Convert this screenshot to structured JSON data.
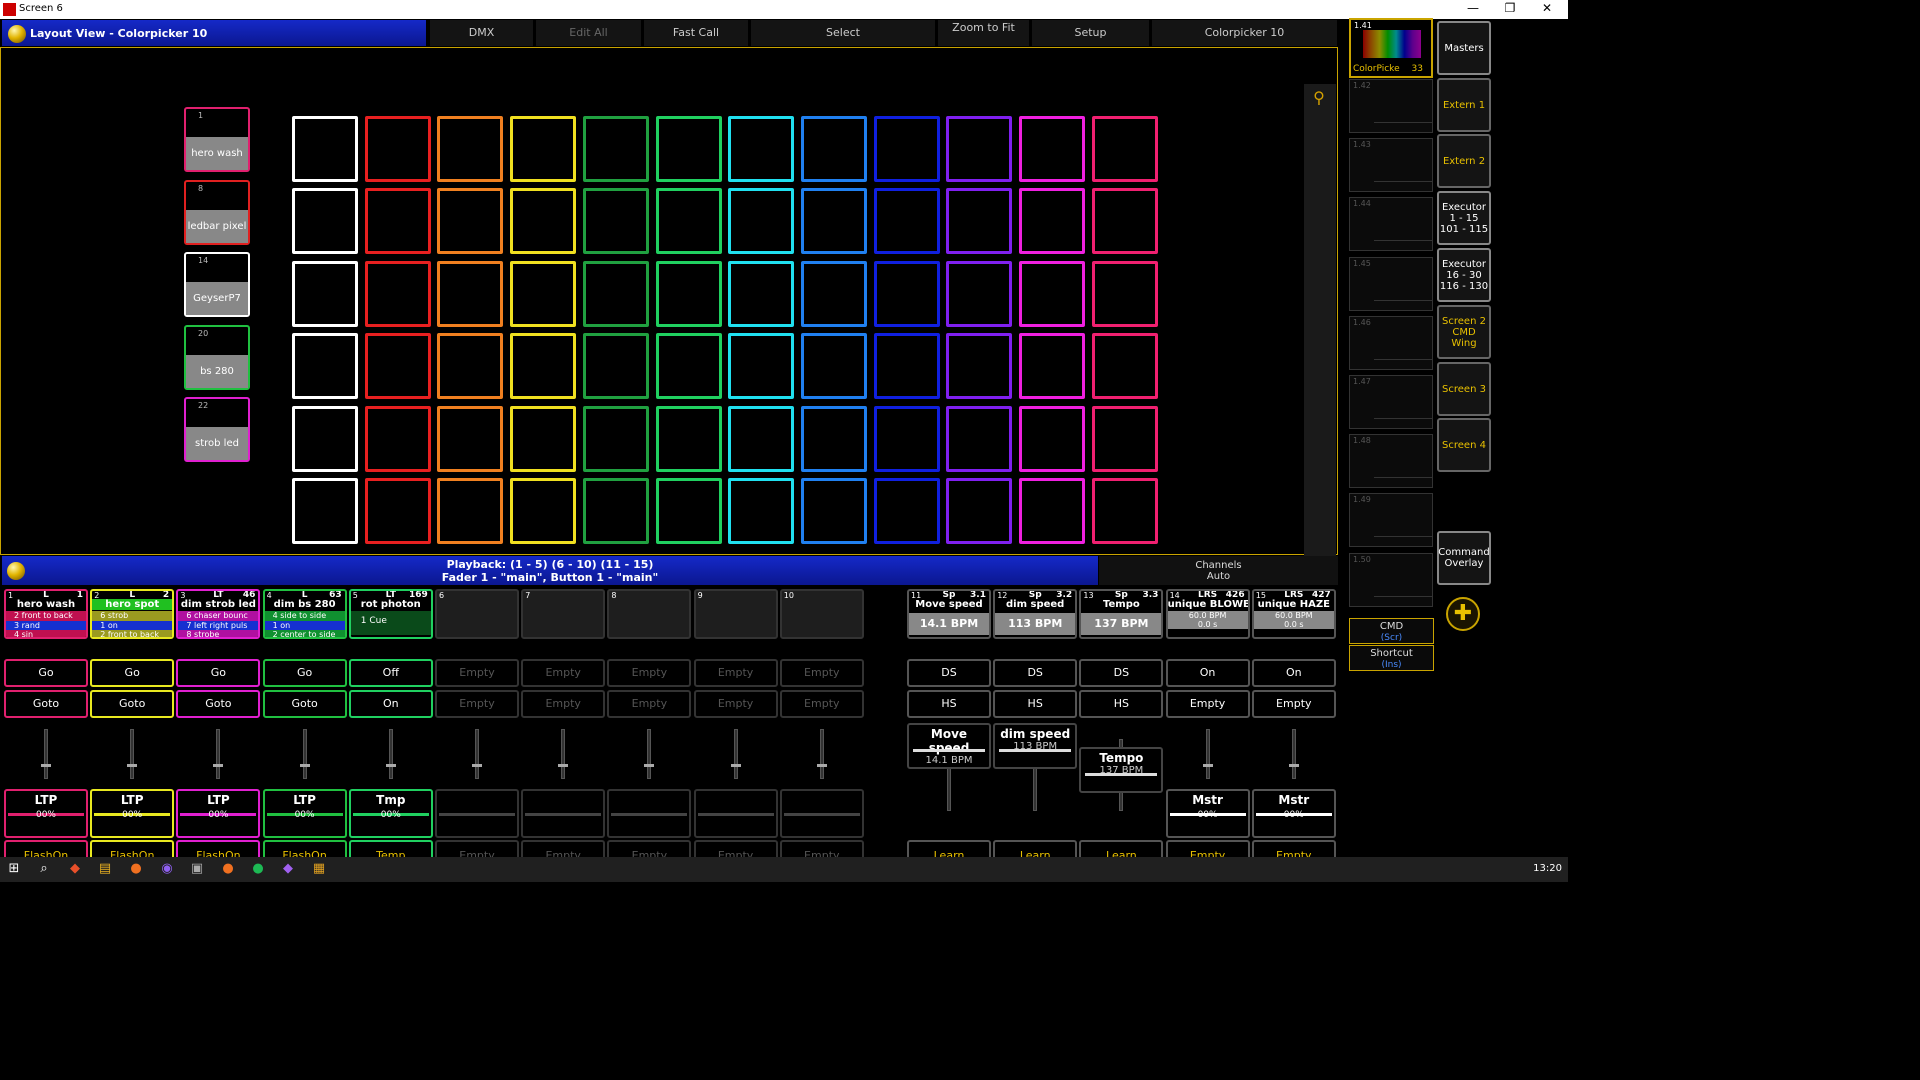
{
  "window": {
    "title": "Screen 6",
    "controls": [
      "—",
      "❐",
      "✕"
    ]
  },
  "header": {
    "title": "Layout View - Colorpicker 10",
    "buttons": [
      "DMX",
      "Edit All",
      "Fast Call",
      "Select",
      "Zoom to Fit",
      "Setup",
      "Colorpicker 10"
    ]
  },
  "fixtures": [
    {
      "num": "1",
      "label": "hero wash",
      "color": "#e0206e"
    },
    {
      "num": "8",
      "label": "ledbar pixel",
      "color": "#e02020"
    },
    {
      "num": "14",
      "label": "GeyserP7",
      "color": "#ffffff"
    },
    {
      "num": "20",
      "label": "bs 280",
      "color": "#20c040"
    },
    {
      "num": "22",
      "label": "strob led",
      "color": "#e020d0"
    }
  ],
  "grid": {
    "rows": 6,
    "colors": [
      "#ffffff",
      "#e82020",
      "#f08020",
      "#f0e020",
      "#20a040",
      "#20d060",
      "#20e0f0",
      "#2080f0",
      "#1020e0",
      "#8020f0",
      "#f020e0",
      "#f02070"
    ]
  },
  "playback": {
    "line1": "Playback: (1 - 5) (6 - 10) (11 - 15)",
    "line2": "Fader  1 - \"main\", Button  1 - \"main\"",
    "channels": "Channels",
    "auto": "Auto"
  },
  "executors": [
    {
      "num": "1",
      "type": "L",
      "right": "1",
      "name": "hero wash",
      "color": "#e0206e",
      "namebg": "#000",
      "cues": [
        {
          "t": "2 front to back",
          "bg": "#c01050"
        },
        {
          "t": "3 rand",
          "bg": "#1530d0"
        },
        {
          "t": "4 sin",
          "bg": "#c01050"
        }
      ],
      "b1": "Go",
      "b2": "Goto",
      "fader": "LTP",
      "pct": "00%",
      "barcolor": "#e0206e",
      "bottom": "FlashOn",
      "bcolor": "#e8c000"
    },
    {
      "num": "2",
      "type": "L",
      "right": "2",
      "name": "hero spot",
      "color": "#e8e820",
      "namebg": "#20c020",
      "cues": [
        {
          "t": "6 strob",
          "bg": "#9a9a20"
        },
        {
          "t": "1 on",
          "bg": "#1530d0"
        },
        {
          "t": "2 front to back",
          "bg": "#9a9a20"
        }
      ],
      "b1": "Go",
      "b2": "Goto",
      "fader": "LTP",
      "pct": "00%",
      "barcolor": "#e8e820",
      "bottom": "FlashOn",
      "bcolor": "#e8c000"
    },
    {
      "num": "3",
      "type": "LT",
      "right": "46",
      "name": "dim strob led",
      "color": "#e020d0",
      "namebg": "#000",
      "cues": [
        {
          "t": "6 chaser bounc",
          "bg": "#b010a0"
        },
        {
          "t": "7 left right puls",
          "bg": "#1530d0"
        },
        {
          "t": "8 strobe",
          "bg": "#b010a0"
        }
      ],
      "b1": "Go",
      "b2": "Goto",
      "fader": "LTP",
      "pct": "00%",
      "barcolor": "#e020d0",
      "bottom": "FlashOn",
      "bcolor": "#e8c000"
    },
    {
      "num": "4",
      "type": "L",
      "right": "63",
      "name": "dim bs 280",
      "color": "#20c040",
      "namebg": "#000",
      "cues": [
        {
          "t": "4 side to side",
          "bg": "#109030"
        },
        {
          "t": "1 on",
          "bg": "#1530d0"
        },
        {
          "t": "2 center to side",
          "bg": "#109030"
        }
      ],
      "b1": "Go",
      "b2": "Goto",
      "fader": "LTP",
      "pct": "00%",
      "barcolor": "#20c040",
      "bottom": "FlashOn",
      "bcolor": "#e8c000"
    },
    {
      "num": "5",
      "type": "LT",
      "right": "169",
      "name": "rot photon",
      "color": "#20d060",
      "namebg": "#000",
      "cues": [
        {
          "t": "1 Cue",
          "bg": "#0a4a1a"
        }
      ],
      "b1": "Off",
      "b2": "On",
      "fader": "Tmp",
      "pct": "00%",
      "barcolor": "#20d060",
      "bottom": "Temp",
      "bcolor": "#e8c000"
    },
    {
      "num": "6",
      "empty": true
    },
    {
      "num": "7",
      "empty": true
    },
    {
      "num": "8",
      "empty": true
    },
    {
      "num": "9",
      "empty": true
    },
    {
      "num": "10",
      "empty": true
    }
  ],
  "empty": {
    "label": "Empty"
  },
  "speedexecs": [
    {
      "num": "11",
      "type": "Sp",
      "right": "3.1",
      "name": "Move speed",
      "bpm": "14.1 BPM",
      "b1": "DS",
      "b2": "HS",
      "spd": "Move speed",
      "spdv": "14.1 BPM",
      "bottom": "Learn"
    },
    {
      "num": "12",
      "type": "Sp",
      "right": "3.2",
      "name": "dim speed",
      "bpm": "113 BPM",
      "b1": "DS",
      "b2": "HS",
      "spd": "dim speed",
      "spdv": "113 BPM",
      "bottom": "Learn"
    },
    {
      "num": "13",
      "type": "Sp",
      "right": "3.3",
      "name": "Tempo",
      "bpm": "137 BPM",
      "b1": "DS",
      "b2": "HS",
      "spd": "Tempo",
      "spdv": "137 BPM",
      "bottom": "Learn"
    },
    {
      "num": "14",
      "type": "LRS",
      "right": "426",
      "name": "unique BLOWER",
      "l1": "60.0 BPM",
      "l2": "0.0 s",
      "b1": "On",
      "b2": "Empty",
      "fader": "Mstr",
      "pct": "00%",
      "bottom": "Empty"
    },
    {
      "num": "15",
      "type": "LRS",
      "right": "427",
      "name": "unique HAZE",
      "l1": "60.0 BPM",
      "l2": "0.0 s",
      "b1": "On",
      "b2": "Empty",
      "fader": "Mstr",
      "pct": "00%",
      "bottom": "Empty"
    }
  ],
  "viewpool": {
    "first": {
      "id": "1.41",
      "name": "ColorPicke",
      "num": "33"
    },
    "others": [
      "1.42",
      "1.43",
      "1.44",
      "1.45",
      "1.46",
      "1.47",
      "1.48",
      "1.49",
      "1.50"
    ]
  },
  "viewnav": [
    "Masters",
    "Extern 1",
    "Extern 2",
    "Executor 1 - 15 101 - 115",
    "Executor 16 - 30 116 - 130",
    "Screen 2 CMD Wing",
    "Screen 3",
    "Screen 4",
    "Command Overlay"
  ],
  "cmd": {
    "label": "CMD",
    "sub": "(Scr)"
  },
  "shortcut": {
    "label": "Shortcut",
    "sub": "(Ins)"
  },
  "taskbar": {
    "time": "13:20",
    "icons": [
      "windows-icon",
      "search-icon",
      "brave-icon",
      "files-icon",
      "firefox-icon",
      "discord-icon",
      "grandma-icon",
      "audacity-icon",
      "spotify-icon",
      "app-icon",
      "app2-icon"
    ]
  }
}
